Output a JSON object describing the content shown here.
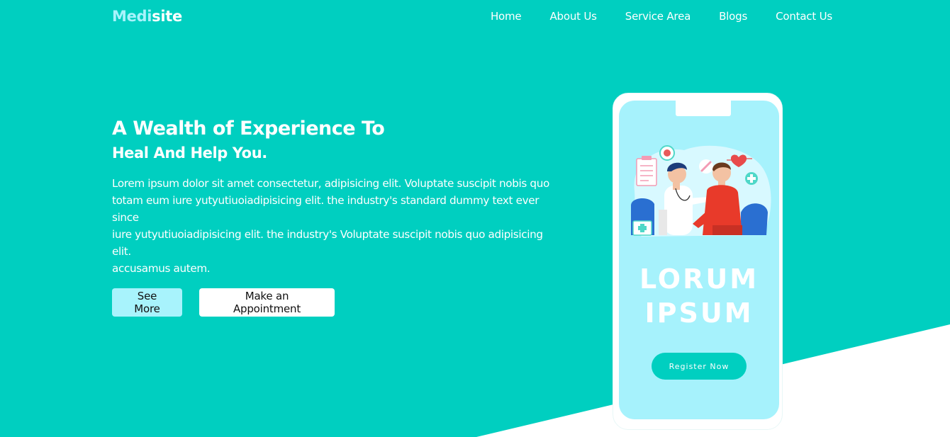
{
  "brand": {
    "logo_part1": "Medi",
    "logo_part2": "site"
  },
  "nav": {
    "items": [
      {
        "label": "Home"
      },
      {
        "label": "About Us"
      },
      {
        "label": "Service Area"
      },
      {
        "label": "Blogs"
      },
      {
        "label": "Contact Us"
      }
    ]
  },
  "hero": {
    "title": "A Wealth of Experience To",
    "subtitle": "Heal And Help You.",
    "description_lines": [
      "Lorem ipsum dolor sit amet consectetur, adipisicing elit. Voluptate suscipit nobis quo",
      "totam eum iure yutyutiuoiadipisicing elit. the industry's standard dummy text ever since",
      "iure yutyutiuoiadipisicing elit. the industry's Voluptate suscipit nobis quo adipisicing elit.",
      "accusamus autem."
    ],
    "see_more_label": "See More",
    "appointment_label": "Make an Appointment"
  },
  "phone": {
    "title_line1": "LORUM",
    "title_line2": "IPSUM",
    "register_label": "Register Now",
    "illustration": "doctor-patient-illustration"
  },
  "colors": {
    "primary": "#00cfc0",
    "accent": "#a8f3fc",
    "screen_bg": "#a6f2fc",
    "white": "#ffffff"
  }
}
